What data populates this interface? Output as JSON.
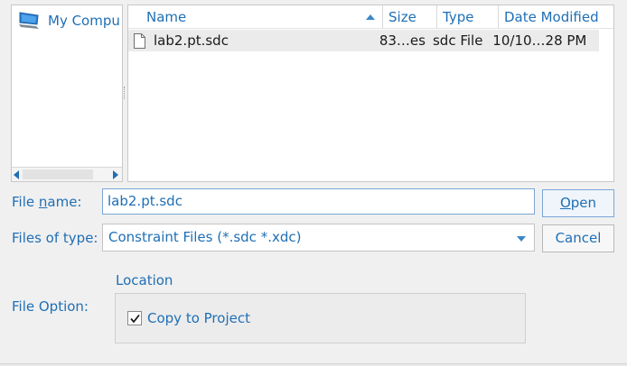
{
  "places": {
    "items": [
      {
        "label": "My Compu",
        "icon": "computer-icon"
      }
    ]
  },
  "file_list": {
    "columns": {
      "name": "Name",
      "size": "Size",
      "type": "Type",
      "date": "Date Modified"
    },
    "rows": [
      {
        "name": "lab2.pt.sdc",
        "size": "83…es",
        "type": "sdc File",
        "date": "10/10…28 PM",
        "icon": "document-icon"
      }
    ]
  },
  "form": {
    "file_name_label_pre": "File ",
    "file_name_label_u": "n",
    "file_name_label_post": "ame:",
    "file_name_value": "lab2.pt.sdc",
    "files_of_type_label": "Files of type:",
    "files_of_type_value": "Constraint Files (*.sdc *.xdc)",
    "open_label_u": "O",
    "open_label_rest": "pen",
    "cancel_label": "Cancel",
    "file_option_label": "File Option:",
    "location_title": "Location",
    "copy_to_project_label": "Copy to Project",
    "copy_to_project_checked": true
  },
  "colors": {
    "accent": "#1f6fb5",
    "background": "#f0f0f0",
    "selected_row": "#ebebeb"
  }
}
